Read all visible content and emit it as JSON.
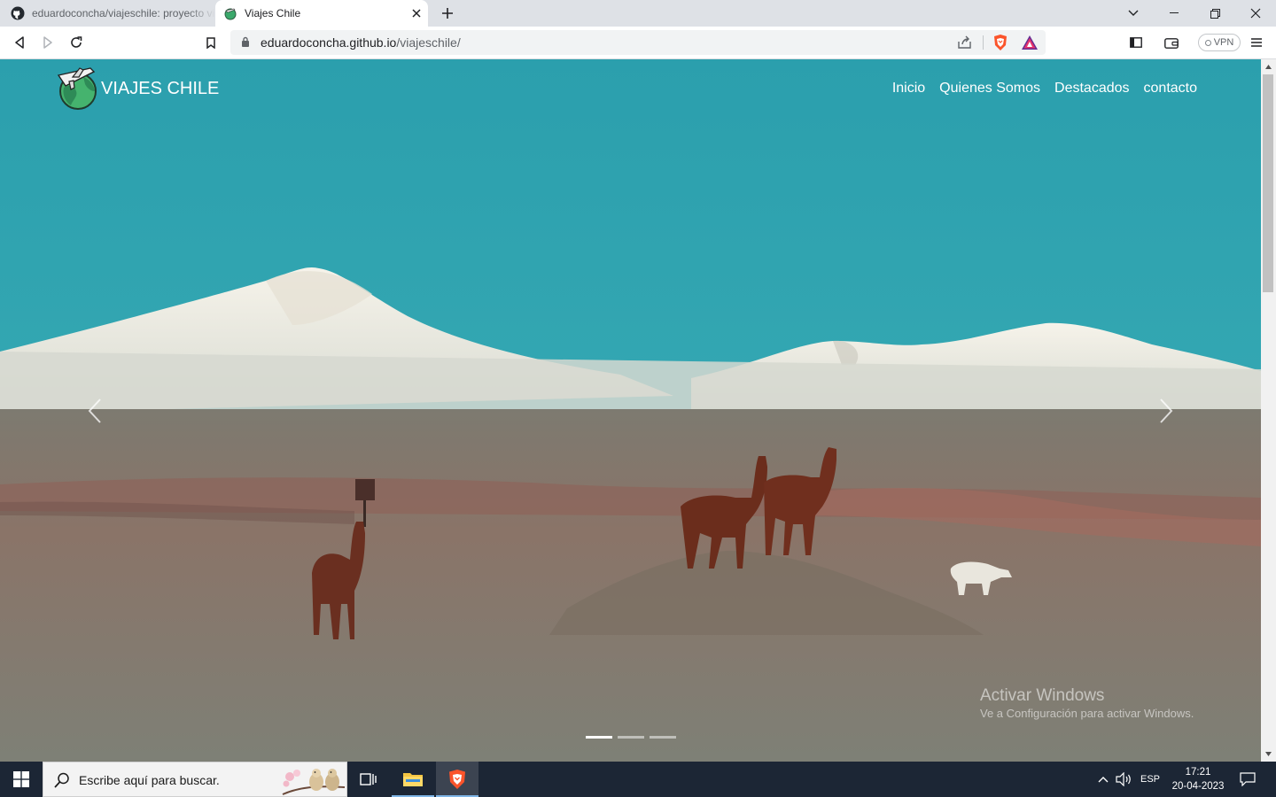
{
  "browser": {
    "tabs": [
      {
        "title": "eduardoconcha/viajeschile: proyecto viajes",
        "icon": "github-icon",
        "active": false
      },
      {
        "title": "Viajes Chile",
        "icon": "globe-airplane-icon",
        "active": true
      }
    ],
    "address": {
      "host": "eduardoconcha.github.io",
      "path": "/viajeschile/"
    },
    "vpn_label": "VPN"
  },
  "page": {
    "brand": "VIAJES CHILE",
    "nav": [
      "Inicio",
      "Quienes Somos",
      "Destacados",
      "contacto"
    ],
    "carousel": {
      "slides": 3,
      "active_index": 0
    },
    "hero_image": "Altiplano landscape with snowy volcano and llamas"
  },
  "watermark": {
    "line1": "Activar Windows",
    "line2": "Ve a Configuración para activar Windows."
  },
  "taskbar": {
    "search_placeholder": "Escribe aquí para buscar.",
    "language": "ESP",
    "time": "17:21",
    "date": "20-04-2023"
  },
  "colors": {
    "sky": "#3aa9b4",
    "taskbar": "#1c2635",
    "brave_orange": "#fb542b"
  }
}
